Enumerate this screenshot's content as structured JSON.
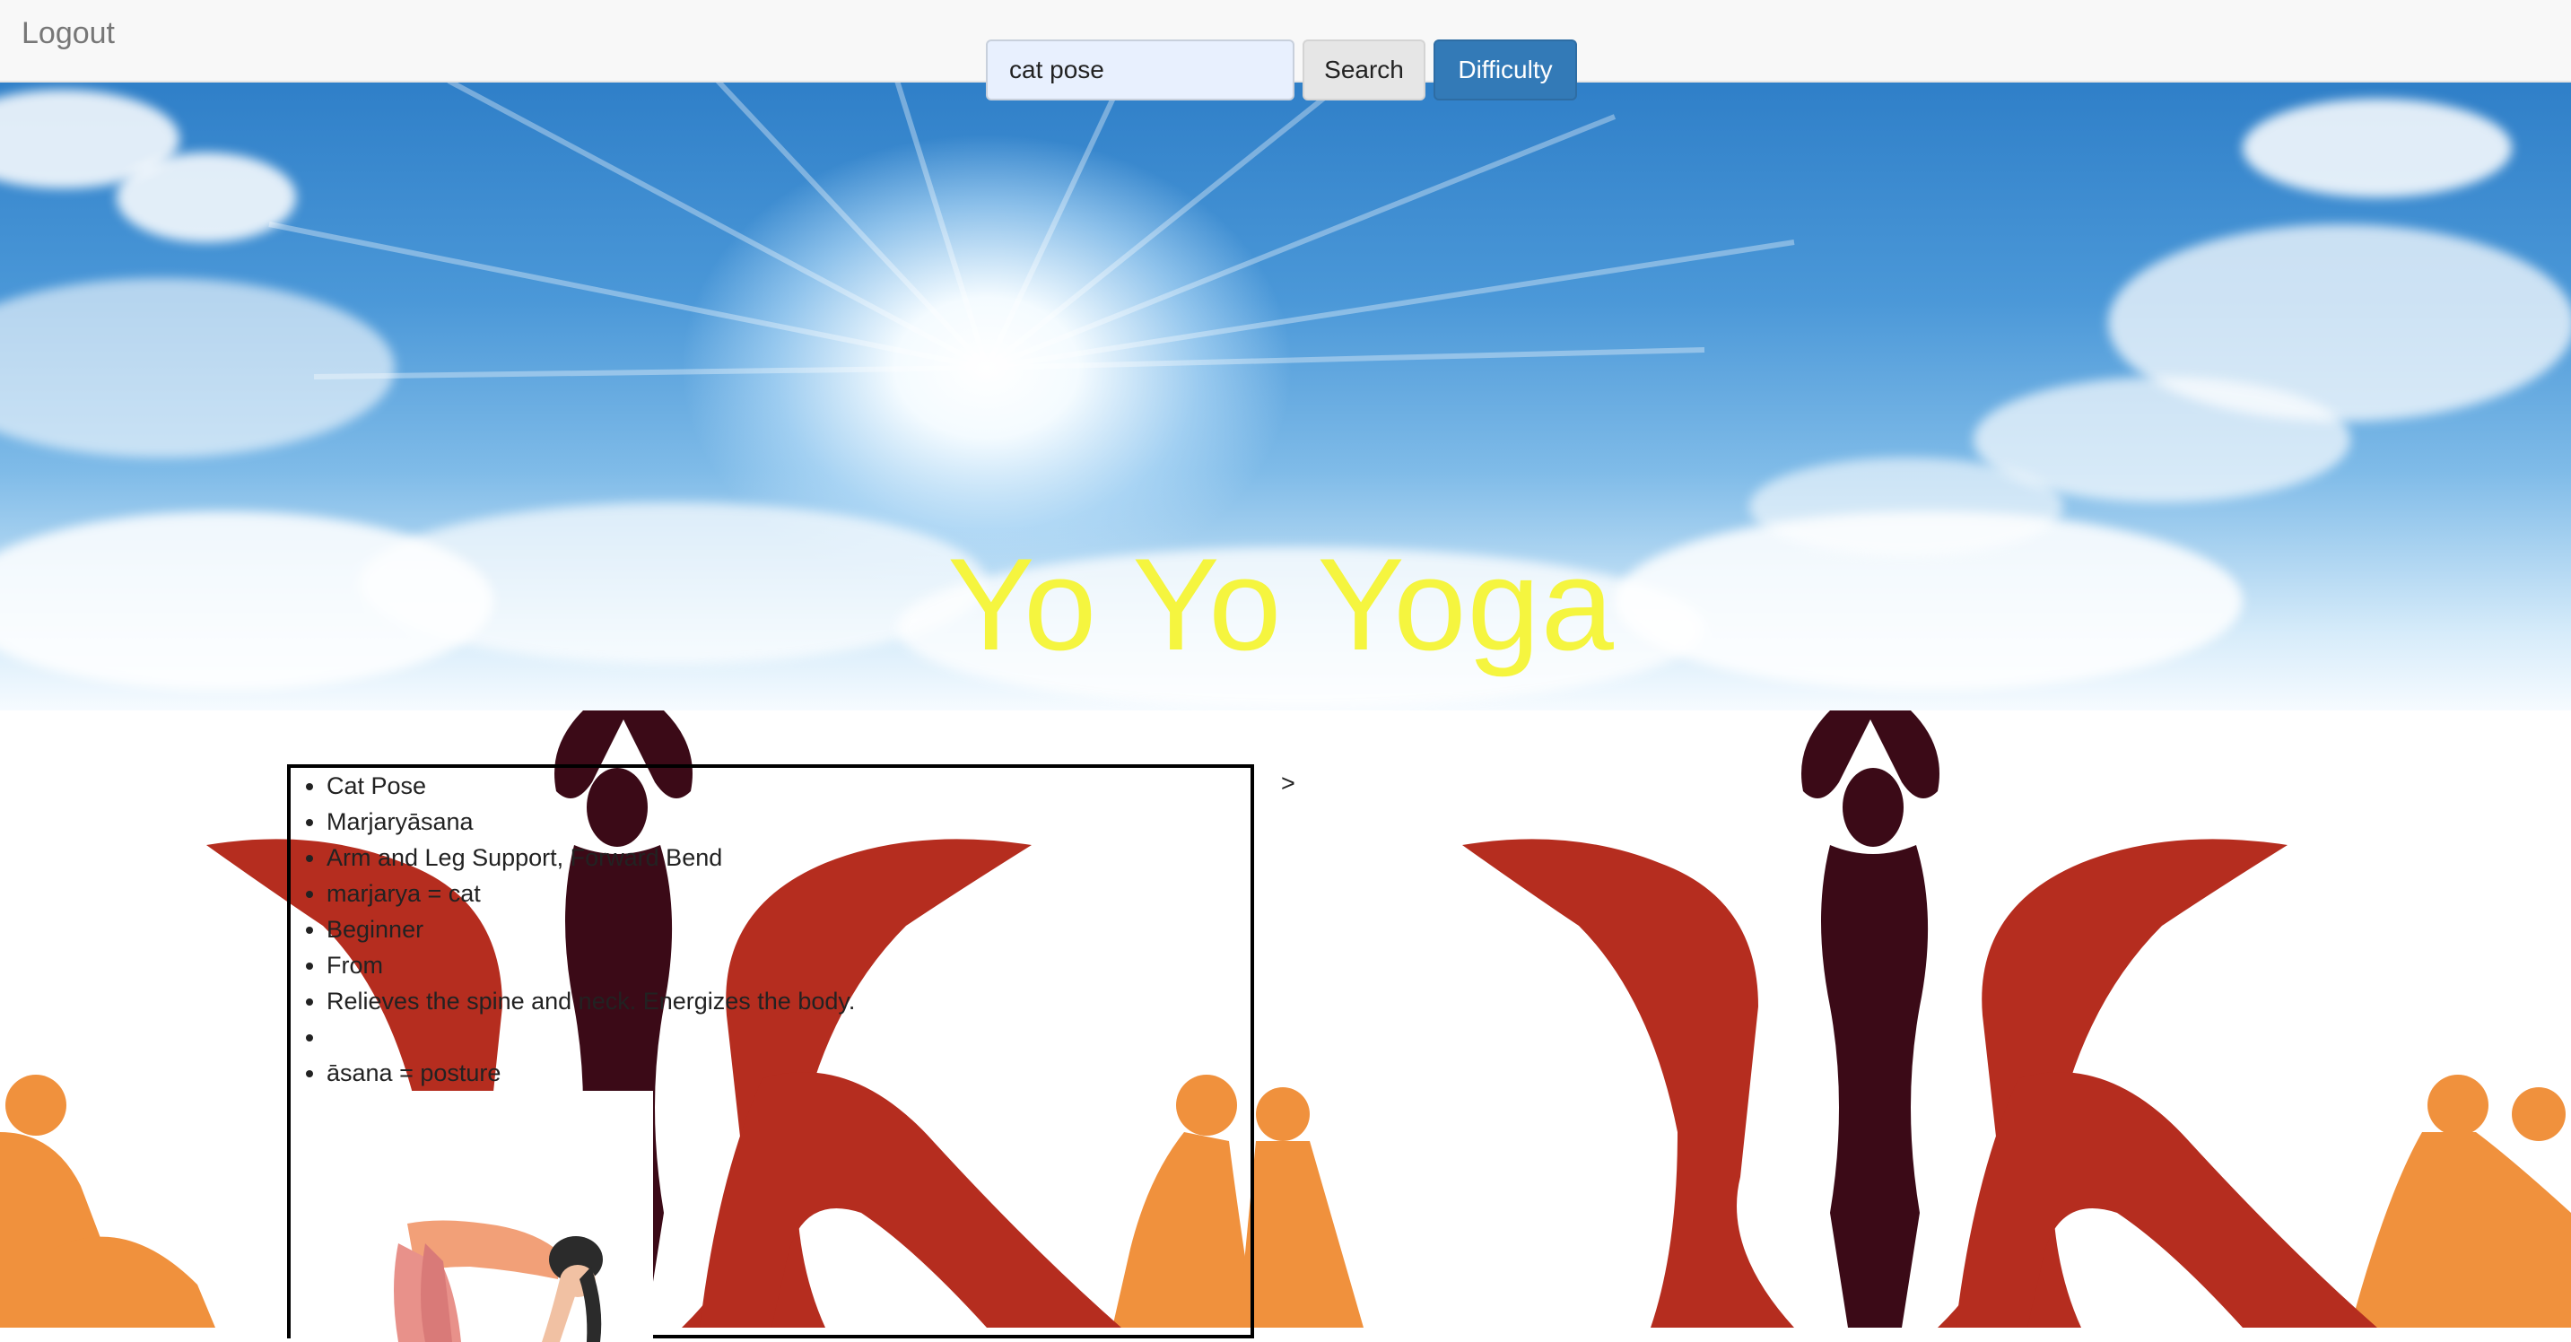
{
  "nav": {
    "logout_label": "Logout"
  },
  "search": {
    "value": "cat pose",
    "button_label": "Search"
  },
  "difficulty": {
    "button_label": "Difficulty"
  },
  "hero": {
    "title": "Yo Yo Yoga",
    "title_color": "#f5f53f"
  },
  "pose": {
    "details": [
      "Cat Pose",
      "Marjaryāsana",
      "Arm and Leg Support, Forward Bend",
      "marjarya = cat",
      "Beginner",
      "From",
      "Relieves the spine and neck. Energizes the body.",
      "",
      "āsana = posture"
    ],
    "image_icon": "yoga-pose-photo"
  },
  "pager": {
    "next_label": ">"
  },
  "colors": {
    "primary": "#337ab7",
    "silhouette_orange": "#f0913d",
    "silhouette_red": "#b52d1f",
    "silhouette_dark": "#3b0a17"
  }
}
